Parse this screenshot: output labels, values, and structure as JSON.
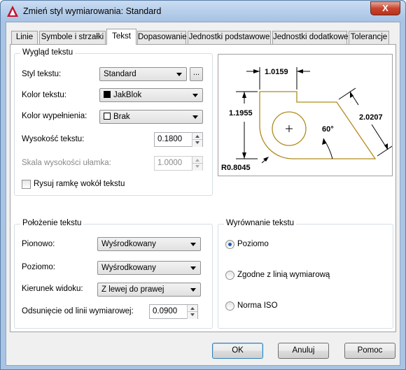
{
  "window": {
    "title": "Zmień styl wymiarowania: Standard",
    "close_label": "X"
  },
  "tabs": [
    "Linie",
    "Symbole i strzałki",
    "Tekst",
    "Dopasowanie",
    "Jednostki podstawowe",
    "Jednostki dodatkowe",
    "Tolerancje"
  ],
  "active_tab": "Tekst",
  "text_appearance": {
    "title": "Wygląd tekstu",
    "text_style_label": "Styl tekstu:",
    "text_style_value": "Standard",
    "browse_label": "...",
    "text_color_label": "Kolor tekstu:",
    "text_color_value": "JakBlok",
    "fill_color_label": "Kolor wypełnienia:",
    "fill_color_value": "Brak",
    "text_height_label": "Wysokość tekstu:",
    "text_height_value": "0.1800",
    "fraction_scale_label": "Skala wysokości ułamka:",
    "fraction_scale_value": "1.0000",
    "frame_checkbox_label": "Rysuj ramkę wokół tekstu"
  },
  "text_placement": {
    "title": "Położenie tekstu",
    "vertical_label": "Pionowo:",
    "vertical_value": "Wyśrodkowany",
    "horizontal_label": "Poziomo:",
    "horizontal_value": "Wyśrodkowany",
    "view_direction_label": "Kierunek widoku:",
    "view_direction_value": "Z lewej do prawej",
    "offset_label": "Odsunięcie od linii wymiarowej:",
    "offset_value": "0.0900"
  },
  "text_alignment": {
    "title": "Wyrównanie tekstu",
    "options": [
      "Poziomo",
      "Zgodne z linią wymiarową",
      "Norma ISO"
    ],
    "selected": "Poziomo"
  },
  "preview": {
    "dim_top": "1.0159",
    "dim_left": "1.1955",
    "dim_right": "2.0207",
    "dim_angle": "60°",
    "dim_radius": "R0.8045"
  },
  "buttons": {
    "ok": "OK",
    "cancel": "Anuluj",
    "help": "Pomoc"
  },
  "colors": {
    "preview_outline": "#b08a1e",
    "radio_selected": "#1c5fae"
  }
}
